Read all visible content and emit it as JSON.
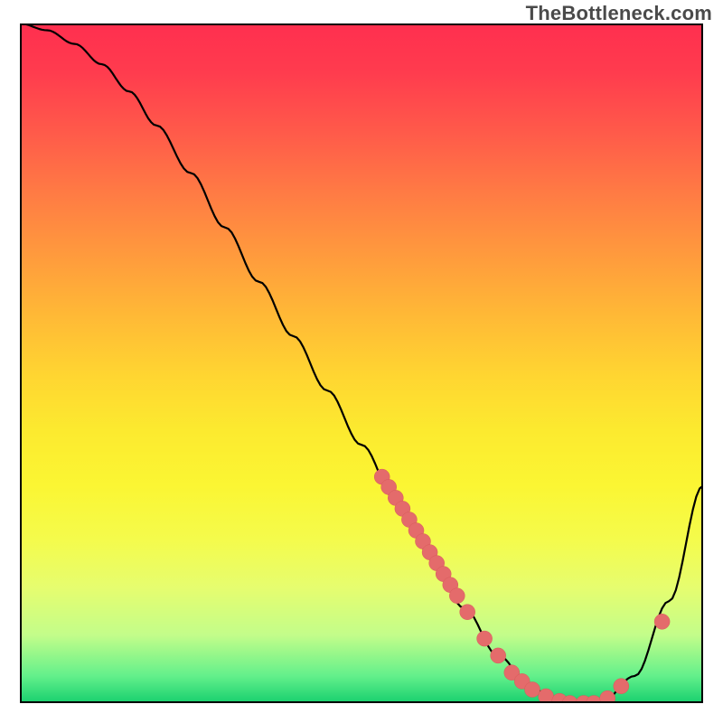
{
  "watermark": "TheBottleneck.com",
  "chart_data": {
    "type": "line",
    "title": "",
    "xlabel": "",
    "ylabel": "",
    "xlim": [
      0,
      100
    ],
    "ylim": [
      0,
      100
    ],
    "series": [
      {
        "name": "bottleneck-curve",
        "x": [
          0,
          4,
          8,
          12,
          16,
          20,
          25,
          30,
          35,
          40,
          45,
          50,
          55,
          60,
          65,
          70,
          75,
          80,
          85,
          90,
          95,
          100
        ],
        "y": [
          100,
          99,
          97,
          94,
          90,
          85,
          78,
          70,
          62,
          54,
          46,
          38,
          30,
          22,
          14,
          7,
          2,
          0,
          0,
          4,
          15,
          32
        ]
      }
    ],
    "scatter_points": {
      "name": "highlighted-points",
      "x": [
        53,
        54,
        55,
        56,
        57,
        58,
        59,
        60,
        61,
        62,
        63,
        64,
        65.5,
        68,
        70,
        72,
        73.5,
        75,
        77,
        79,
        80.5,
        82.5,
        84,
        86,
        88,
        94
      ],
      "y": [
        33.3,
        31.8,
        30.2,
        28.6,
        27.0,
        25.4,
        23.8,
        22.2,
        20.6,
        19.0,
        17.4,
        15.8,
        13.4,
        9.5,
        7.0,
        4.5,
        3.2,
        2.0,
        1.0,
        0.3,
        0.0,
        0.0,
        0.0,
        0.7,
        2.5,
        12.0
      ]
    },
    "background": {
      "type": "vertical-gradient",
      "stops": [
        {
          "pos": 0.0,
          "color": "#ff2f4f"
        },
        {
          "pos": 0.5,
          "color": "#ffd631"
        },
        {
          "pos": 0.8,
          "color": "#f4fb4c"
        },
        {
          "pos": 1.0,
          "color": "#18cf6e"
        }
      ]
    }
  },
  "colors": {
    "scatter": "#e46b6b",
    "curve": "#000000"
  }
}
